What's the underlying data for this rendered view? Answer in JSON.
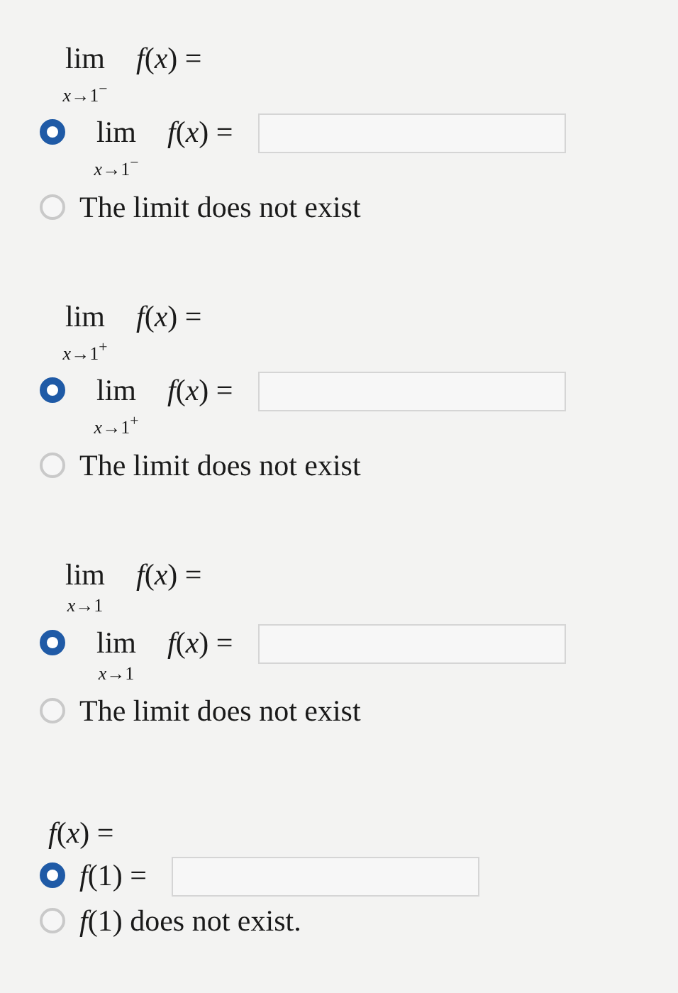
{
  "sections": [
    {
      "heading": {
        "lim": "lim",
        "sub": "*x*→1$^{−}$",
        "expr": "*f*(*x*) ="
      },
      "options": [
        {
          "kind": "input",
          "selected": true,
          "lim": "lim",
          "sub": "*x*→1$^{−}$",
          "expr": "*f*(*x*) ="
        },
        {
          "kind": "text",
          "selected": false,
          "text": "The limit does not exist"
        }
      ]
    },
    {
      "heading": {
        "lim": "lim",
        "sub": "*x*→1$^{+}$",
        "expr": "*f*(*x*) ="
      },
      "options": [
        {
          "kind": "input",
          "selected": true,
          "lim": "lim",
          "sub": "*x*→1$^{+}$",
          "expr": "*f*(*x*) ="
        },
        {
          "kind": "text",
          "selected": false,
          "text": "The limit does not exist"
        }
      ]
    },
    {
      "heading": {
        "lim": "lim",
        "sub": "*x*→1",
        "expr": "*f*(*x*) ="
      },
      "options": [
        {
          "kind": "input",
          "selected": true,
          "lim": "lim",
          "sub": "*x*→1",
          "expr": "*f*(*x*) ="
        },
        {
          "kind": "text",
          "selected": false,
          "text": "The limit does not exist"
        }
      ]
    },
    {
      "heading": {
        "expr": "*f*(*x*) ="
      },
      "options": [
        {
          "kind": "input",
          "selected": true,
          "expr": "*f*(1) ="
        },
        {
          "kind": "text",
          "selected": false,
          "text": "*f*(1) does not exist."
        }
      ]
    }
  ]
}
